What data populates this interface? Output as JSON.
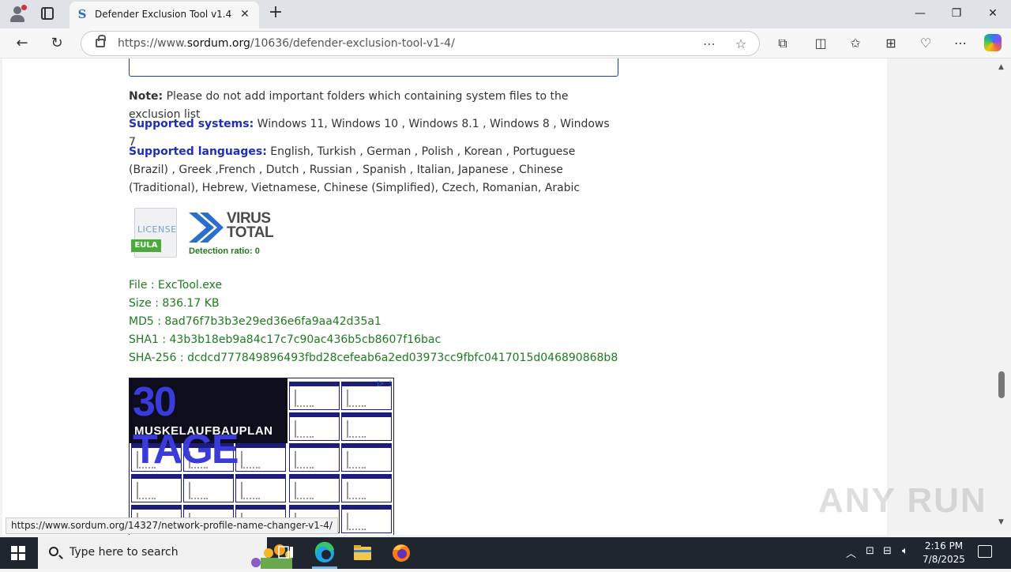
{
  "browser": {
    "tab_title": "Defender Exclusion Tool v1.4",
    "url_prefix": "https://www.",
    "url_domain": "sordum.org",
    "url_path": "/10636/defender-exclusion-tool-v1-4/",
    "status_url": "https://www.sordum.org/14327/network-profile-name-changer-v1-4/"
  },
  "content": {
    "note_label": "Note:",
    "note_text": " Please do not add important folders which containing system files to the exclusion list",
    "systems_label": "Supported systems:",
    "systems_text": " Windows 11, Windows 10 , Windows 8.1 , Windows 8 , Windows 7",
    "languages_label": "Supported languages:",
    "languages_text": " English, Turkish , German , Polish , Korean , Portuguese (Brazil) , Greek ,French , Dutch , Russian , Spanish , Italian, Japanese , Chinese (Traditional), Hebrew, Vietnamese, Chinese (Simplified), Czech, Romanian, Arabic",
    "eula_license": "LICENSE",
    "eula_tag": "EULA",
    "virustotal_line1": "VIRUS",
    "virustotal_line2": "TOTAL",
    "detection_ratio": "Detection ratio:  0",
    "file": "File : ExcTool.exe",
    "size": "Size : 836.17 KB",
    "md5": "MD5 : 8ad76f7b3b3e29ed36e6fa9aa42d35a1",
    "sha1": "SHA1 : 43b3b18eb9a84c17c7c90ac436b5cb8607f16bac",
    "sha256": "SHA-256 : dcdcd777849896493fbd28cefeab6a2ed03973cc9fbfc0417015d046890868b8"
  },
  "ad": {
    "headline": "30 TAGE",
    "subline": "MUSKELAUFBAUPLAN"
  },
  "watermark": "ANY RUN",
  "taskbar": {
    "search_placeholder": "Type here to search",
    "time": "2:16 PM",
    "date": "7/8/2025"
  },
  "colors": {
    "link_blue": "#1f2fb5",
    "hash_green": "#1f7a1f",
    "taskbar": "#1f2630"
  }
}
